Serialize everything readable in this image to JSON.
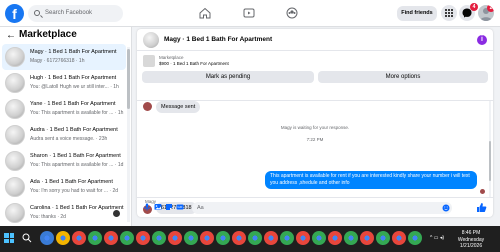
{
  "topnav": {
    "search_placeholder": "Search Facebook",
    "find_friends": "Find friends",
    "messenger_badge": "4",
    "notifications_badge": "2"
  },
  "sidebar": {
    "title": "Marketplace",
    "conversations": [
      {
        "name": "Magy · 1 Bed 1 Bath For Apartment",
        "preview": "Magy · 6172766318 · 1h",
        "active": true,
        "unread": false
      },
      {
        "name": "Hugh · 1 Bed 1 Bath For Apartment",
        "preview": "You: @Latoll Hugh we ur still inter... · 1h",
        "active": false,
        "unread": false
      },
      {
        "name": "Yane · 1 Bed 1 Bath For Apartment",
        "preview": "You: This apartment is available for ... · 1h",
        "active": false,
        "unread": false
      },
      {
        "name": "Audra · 1 Bed 1 Bath For Apartment",
        "preview": "Audra sent a voice message. · 23h",
        "active": false,
        "unread": false
      },
      {
        "name": "Sharon · 1 Bed 1 Bath For Apartment",
        "preview": "You: This apartment is available for ... · 1d",
        "active": false,
        "unread": false
      },
      {
        "name": "Ada · 1 Bed 1 Bath For Apartment",
        "preview": "You: I'm sorry you had to wait for ... · 2d",
        "active": false,
        "unread": false
      },
      {
        "name": "Carolina · 1 Bed 1 Bath For Apartment",
        "preview": "You: thanks · 2d",
        "active": false,
        "unread": false
      }
    ]
  },
  "chat": {
    "title": "Magy · 1 Bed 1 Bath For Apartment",
    "listing_label": "Marketplace",
    "listing_price": "$900 · 1 Bed 1 Bath For Apartment",
    "mark_pending": "Mark as pending",
    "more_options": "More options",
    "msg_sent": "Message sent",
    "waiting": "Magy is waiting for your response.",
    "time": "7:22 PM",
    "outgoing": "This apartment is available  for rent if you are interested kindly share your number i will text you address ,shedule and other info",
    "sender": "Magy",
    "incoming_phone": "6172766318",
    "composer_placeholder": "Aa"
  },
  "taskbar": {
    "time": "8:46 PM",
    "day": "Wednesday",
    "date": "1/21/2026",
    "sys_icons": "^ ▭ ◂)",
    "app_colors": [
      "#3a7bd5",
      "#f4b400",
      "#e8463c",
      "#34a853",
      "#e8463c",
      "#34a853",
      "#e8463c",
      "#34a853",
      "#e8463c",
      "#34a853",
      "#e8463c",
      "#34a853",
      "#e8463c",
      "#34a853",
      "#e8463c",
      "#34a853",
      "#e8463c",
      "#34a853",
      "#e8463c",
      "#34a853",
      "#e8463c",
      "#34a853",
      "#e8463c",
      "#34a853"
    ]
  },
  "colors": {
    "brand": "#1877f2",
    "bubble_out": "#0084ff",
    "active_row": "#e7f3ff",
    "info_icon": "#8a2be2"
  }
}
